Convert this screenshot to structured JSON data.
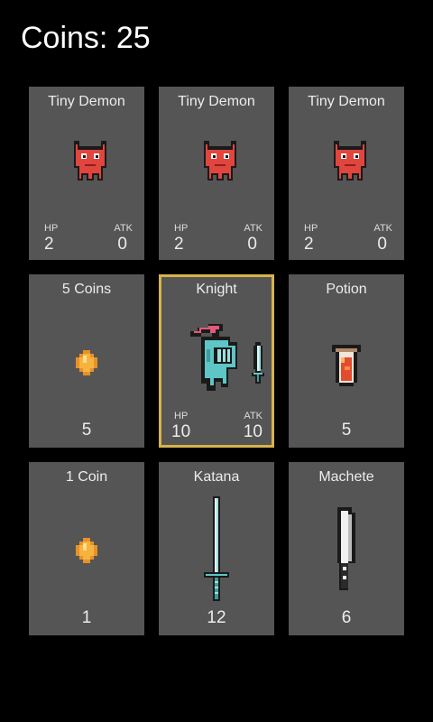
{
  "header": {
    "coins_label": "Coins: 25"
  },
  "cards": [
    {
      "name": "Tiny Demon",
      "hp_label": "HP",
      "hp": "2",
      "atk_label": "ATK",
      "atk": "0",
      "icon": "tiny-demon-icon"
    },
    {
      "name": "Tiny Demon",
      "hp_label": "HP",
      "hp": "2",
      "atk_label": "ATK",
      "atk": "0",
      "icon": "tiny-demon-icon"
    },
    {
      "name": "Tiny Demon",
      "hp_label": "HP",
      "hp": "2",
      "atk_label": "ATK",
      "atk": "0",
      "icon": "tiny-demon-icon"
    },
    {
      "name": "5 Coins",
      "value": "5",
      "icon": "coin-icon"
    },
    {
      "name": "Knight",
      "hp_label": "HP",
      "hp": "10",
      "atk_label": "ATK",
      "atk": "10",
      "icon": "knight-icon",
      "selected": true
    },
    {
      "name": "Potion",
      "value": "5",
      "icon": "potion-icon"
    },
    {
      "name": "1 Coin",
      "value": "1",
      "icon": "coin-icon"
    },
    {
      "name": "Katana",
      "value": "12",
      "icon": "katana-icon"
    },
    {
      "name": "Machete",
      "value": "6",
      "icon": "machete-icon"
    }
  ],
  "colors": {
    "background": "#000000",
    "card": "#555555",
    "selected_border": "#d7b34a",
    "demon": "#e0453e",
    "coin": "#f2a938",
    "knight": "#5ec6c6",
    "plume": "#e5587a",
    "potion": "#e24b2e"
  }
}
